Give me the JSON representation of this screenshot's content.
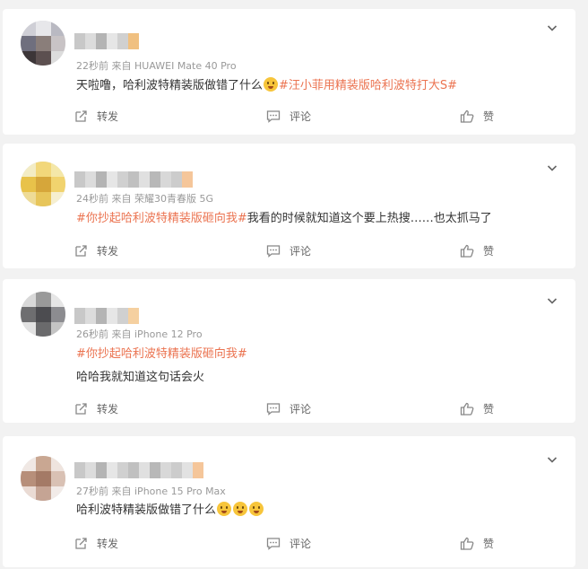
{
  "comments": [
    {
      "time": "22秒前",
      "source_prefix": "来自",
      "device": "HUAWEI Mate 40 Pro",
      "text_before": "天啦噜，哈利波特精装版做错了什么",
      "emoji_count": 1,
      "topic": "#汪小菲用精装版哈利波特打大S#",
      "text_after": "",
      "second_line": "",
      "avatar_colors": [
        "#cfcfd6",
        "#e7e7ea",
        "#b9b9c2",
        "#6f6f7e",
        "#8a7e7a",
        "#c8c3c5",
        "#3c3638",
        "#5c5050",
        "#dcdcdc"
      ],
      "name_colors": [
        "#c8c8c8",
        "#dcdcdc",
        "#b4b4b4",
        "#e6e6e6",
        "#d0d0d0",
        "#f0c080"
      ]
    },
    {
      "time": "24秒前",
      "source_prefix": "来自",
      "device": "荣耀30青春版 5G",
      "text_before": "",
      "emoji_count": 0,
      "topic": "#你抄起哈利波特精装版砸向我#",
      "text_after": "我看的时候就知道这个要上热搜……也太抓马了",
      "second_line": "",
      "avatar_colors": [
        "#f3ecc4",
        "#f2d77a",
        "#f4e7a8",
        "#e8c24a",
        "#d6a63a",
        "#f1d36e",
        "#eedb96",
        "#e7c55a",
        "#f6efd0"
      ],
      "name_colors": [
        "#c8c8c8",
        "#dcdcdc",
        "#b4b4b4",
        "#e6e6e6",
        "#d0d0d0",
        "#c0c0c0",
        "#e0e0e0",
        "#b8b8b8",
        "#d8d8d8",
        "#cccccc",
        "#f5c69a"
      ]
    },
    {
      "time": "26秒前",
      "source_prefix": "来自",
      "device": "iPhone 12 Pro",
      "text_before": "",
      "emoji_count": 0,
      "topic": "#你抄起哈利波特精装版砸向我#",
      "text_after": "",
      "second_line": "哈哈我就知道这句话会火",
      "avatar_colors": [
        "#d8d8d8",
        "#9a9a9a",
        "#e6e6e6",
        "#6e6e70",
        "#4c4c50",
        "#8c8c90",
        "#e2e2e2",
        "#6a6a6c",
        "#c4c4c4"
      ],
      "name_colors": [
        "#c8c8c8",
        "#dcdcdc",
        "#b4b4b4",
        "#e6e6e6",
        "#d0d0d0",
        "#f5d0a0"
      ]
    },
    {
      "time": "27秒前",
      "source_prefix": "来自",
      "device": "iPhone 15 Pro Max",
      "text_before": "哈利波特精装版做错了什么",
      "emoji_count": 3,
      "topic": "",
      "text_after": "",
      "second_line": "",
      "avatar_colors": [
        "#f0e8e4",
        "#c9a792",
        "#efe4de",
        "#b78f7a",
        "#a47a66",
        "#d9c1b4",
        "#eadbd4",
        "#c5a494",
        "#f2ebe8"
      ],
      "name_colors": [
        "#c8c8c8",
        "#dcdcdc",
        "#b4b4b4",
        "#e6e6e6",
        "#d0d0d0",
        "#c0c0c0",
        "#e0e0e0",
        "#b8b8b8",
        "#d8d8d8",
        "#cccccc",
        "#e2e2e2",
        "#f5c69a"
      ]
    }
  ],
  "actions": {
    "share_label": "转发",
    "comment_label": "评论",
    "like_label": "赞"
  },
  "colors": {
    "topic": "#eb7350",
    "meta": "#999999",
    "background": "#f2f2f2"
  }
}
